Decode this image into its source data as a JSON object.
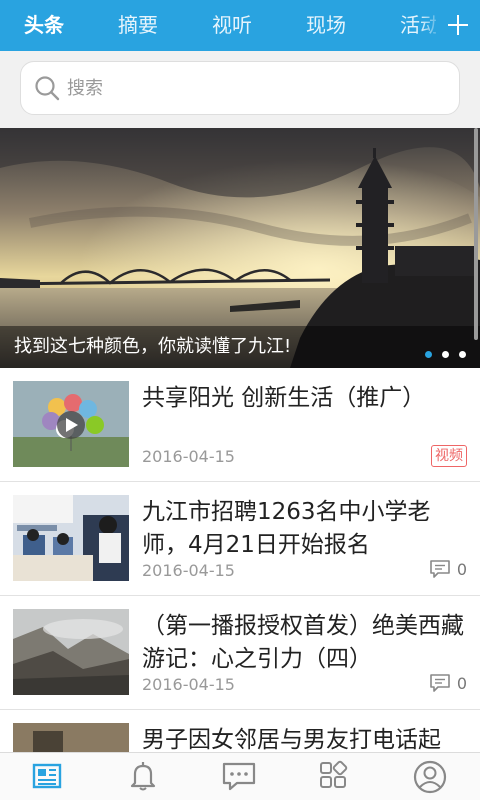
{
  "tabs": [
    "头条",
    "摘要",
    "视听",
    "现场",
    "活动"
  ],
  "accent": "#29a3e0",
  "search": {
    "placeholder": "搜索",
    "icon": "search-icon"
  },
  "banner": {
    "caption": "找到这七种颜色，你就读懂了九江!",
    "slide_count": 3,
    "active_slide": 1
  },
  "news": [
    {
      "title": "共享阳光 创新生活（推广）",
      "date": "2016-04-15",
      "badge": "视频",
      "thumb": "balloons-video"
    },
    {
      "title": "九江市招聘1263名中小学老师，4月21日开始报名",
      "date": "2016-04-15",
      "comments": "0",
      "thumb": "classroom"
    },
    {
      "title": "（第一播报授权首发）绝美西藏游记：心之引力（四）",
      "date": "2016-04-15",
      "comments": "0",
      "thumb": "mountains"
    },
    {
      "title": "男子因女邻居与男友打电话起",
      "date": "",
      "thumb": "street"
    }
  ],
  "bottom_nav": [
    {
      "icon": "news-icon",
      "active": true
    },
    {
      "icon": "bell-icon",
      "active": false
    },
    {
      "icon": "chat-icon",
      "active": false
    },
    {
      "icon": "apps-icon",
      "active": false
    },
    {
      "icon": "user-icon",
      "active": false
    }
  ]
}
